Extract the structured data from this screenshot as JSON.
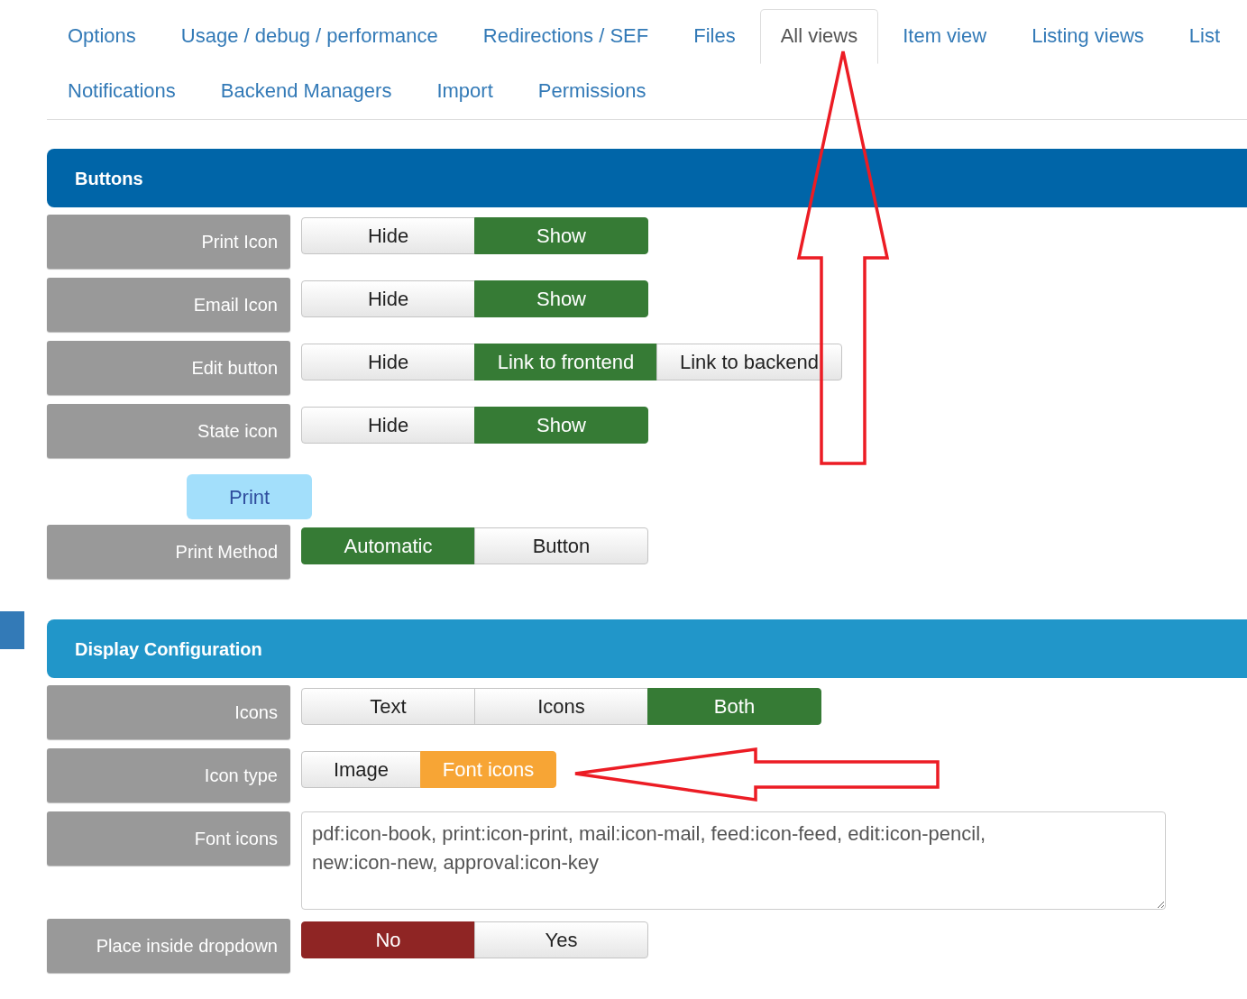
{
  "tab_rows": [
    [
      {
        "label": "Options",
        "selected": false
      },
      {
        "label": "Usage / debug / performance",
        "selected": false
      },
      {
        "label": "Redirections / SEF",
        "selected": false
      },
      {
        "label": "Files",
        "selected": false
      },
      {
        "label": "All views",
        "selected": true
      },
      {
        "label": "Item view",
        "selected": false
      },
      {
        "label": "Listing views",
        "selected": false
      },
      {
        "label": "List",
        "selected": false
      }
    ],
    [
      {
        "label": "Notifications",
        "selected": false
      },
      {
        "label": "Backend Managers",
        "selected": false
      },
      {
        "label": "Import",
        "selected": false
      },
      {
        "label": "Permissions",
        "selected": false
      }
    ]
  ],
  "sections": [
    {
      "title": "Buttons",
      "kind": "dark",
      "rows": [
        {
          "kind": "toggle",
          "label": "Print Icon",
          "color": "#367b35",
          "options": [
            {
              "label": "Hide",
              "selected": false
            },
            {
              "label": "Show",
              "selected": true
            }
          ]
        },
        {
          "kind": "toggle",
          "label": "Email Icon",
          "color": "#367b35",
          "options": [
            {
              "label": "Hide",
              "selected": false
            },
            {
              "label": "Show",
              "selected": true
            }
          ]
        },
        {
          "kind": "toggle",
          "label": "Edit button",
          "color": "#367b35",
          "options": [
            {
              "label": "Hide",
              "selected": false
            },
            {
              "label": "Link to frontend",
              "selected": true
            },
            {
              "label": "Link to backend",
              "selected": false
            }
          ]
        },
        {
          "kind": "toggle",
          "label": "State icon",
          "color": "#367b35",
          "options": [
            {
              "label": "Hide",
              "selected": false
            },
            {
              "label": "Show",
              "selected": true
            }
          ]
        },
        {
          "kind": "button",
          "label": "Print"
        },
        {
          "kind": "toggle",
          "label": "Print Method",
          "color": "#367b35",
          "options": [
            {
              "label": "Automatic",
              "selected": true
            },
            {
              "label": "Button",
              "selected": false
            }
          ]
        }
      ]
    },
    {
      "title": "Display Configuration",
      "kind": "light",
      "rows": [
        {
          "kind": "toggle",
          "label": "Icons",
          "color": "#367b35",
          "options": [
            {
              "label": "Text",
              "selected": false
            },
            {
              "label": "Icons",
              "selected": false
            },
            {
              "label": "Both",
              "selected": true
            }
          ]
        },
        {
          "kind": "toggle",
          "label": "Icon type",
          "color": "#f7a535",
          "options": [
            {
              "label": "Image",
              "selected": false
            },
            {
              "label": "Font icons",
              "selected": true
            }
          ]
        },
        {
          "kind": "textarea",
          "label": "Font icons",
          "value": "pdf:icon-book, print:icon-print, mail:icon-mail, feed:icon-feed, edit:icon-pencil, new:icon-new, approval:icon-key"
        },
        {
          "kind": "toggle",
          "label": "Place inside dropdown",
          "color": "#8f2524",
          "options": [
            {
              "label": "No",
              "selected": true
            },
            {
              "label": "Yes",
              "selected": false
            }
          ]
        }
      ]
    }
  ]
}
